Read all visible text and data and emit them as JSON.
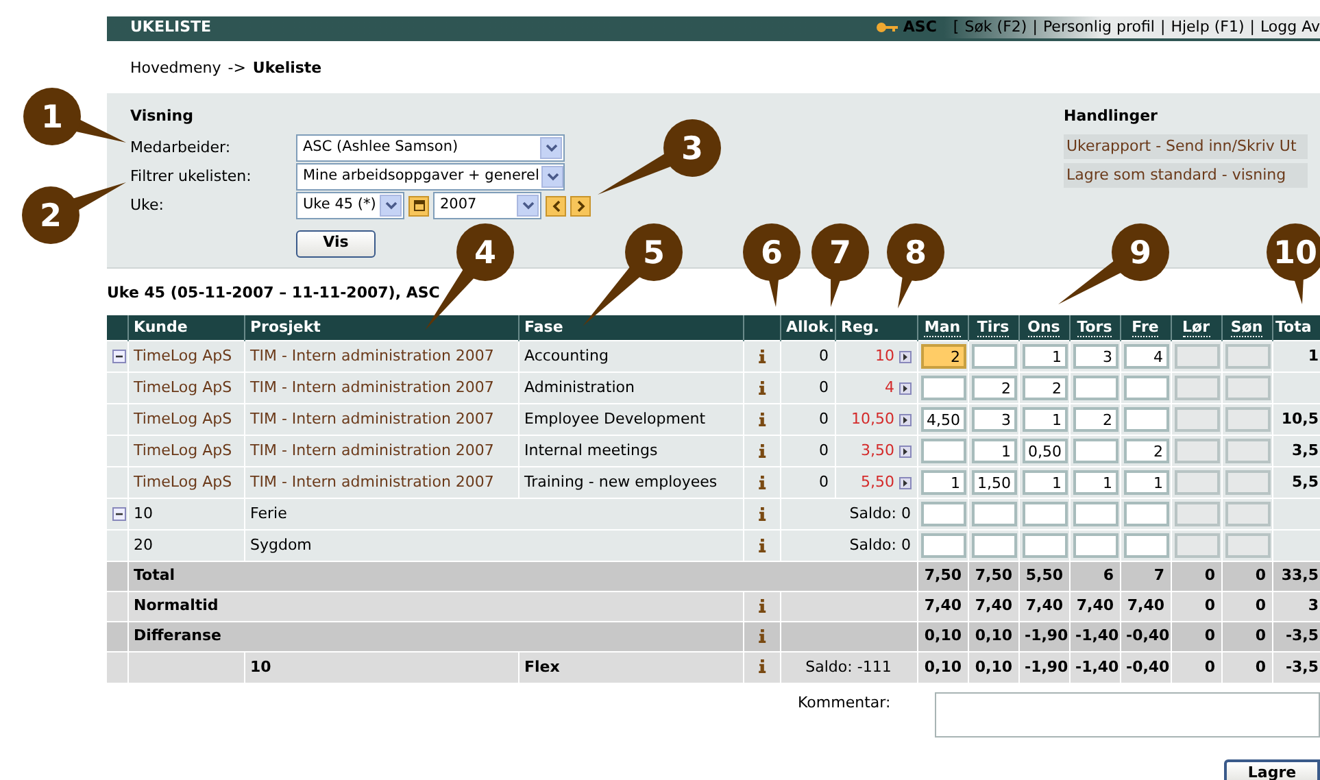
{
  "header": {
    "title": "UKELISTE",
    "user": "ASC",
    "open_bracket": "[",
    "separator": "|",
    "links": [
      "Søk (F2)",
      "Personlig profil",
      "Hjelp (F1)",
      "Logg Av"
    ]
  },
  "breadcrumb": {
    "parent": "Hovedmeny",
    "arrow": "->",
    "current": "Ukeliste"
  },
  "view": {
    "heading": "Visning",
    "fields": [
      {
        "kind": "select",
        "label": "Medarbeider:",
        "value": "ASC (Ashlee Samson)"
      },
      {
        "kind": "select",
        "label": "Filtrer ukelisten:",
        "value": "Mine arbeidsoppgaver + generel"
      },
      {
        "kind": "week",
        "label": "Uke:",
        "value": "Uke 45 (*)",
        "year": "2007"
      }
    ],
    "button": "Vis"
  },
  "actions": {
    "heading": "Handlinger",
    "items": [
      "Ukerapport - Send inn/Skriv Ut",
      "Lagre som standard - visning"
    ]
  },
  "week_title": "Uke 45 (05-11-2007 – 11-11-2007), ASC",
  "table": {
    "columns": [
      "Kunde",
      "Prosjekt",
      "Fase",
      "Allok.",
      "Reg."
    ],
    "days": [
      "Man",
      "Tirs",
      "Ons",
      "Tors",
      "Fre",
      "Lør",
      "Søn"
    ],
    "total_column": "Tota",
    "rows": [
      {
        "kind": "task",
        "collapsible": true,
        "customer": "TimeLog ApS",
        "project": "TIM - Intern administration 2007",
        "phase": "Accounting",
        "allocated": "0",
        "registered": "10",
        "total": "1",
        "cells": [
          {
            "value": "2",
            "focused": true,
            "disabled": false
          },
          {
            "focused": false,
            "disabled": false
          },
          {
            "value": "1",
            "focused": false,
            "disabled": false
          },
          {
            "value": "3",
            "focused": false,
            "disabled": false
          },
          {
            "value": "4",
            "focused": false,
            "disabled": false
          },
          {
            "focused": false,
            "disabled": true
          },
          {
            "focused": false,
            "disabled": true
          }
        ]
      },
      {
        "kind": "task",
        "collapsible": false,
        "customer": "TimeLog ApS",
        "project": "TIM - Intern administration 2007",
        "phase": "Administration",
        "allocated": "0",
        "registered": "4",
        "cells": [
          {
            "focused": false,
            "disabled": false
          },
          {
            "value": "2",
            "focused": false,
            "disabled": false
          },
          {
            "value": "2",
            "focused": false,
            "disabled": false
          },
          {
            "focused": false,
            "disabled": false
          },
          {
            "focused": false,
            "disabled": false
          },
          {
            "focused": false,
            "disabled": true
          },
          {
            "focused": false,
            "disabled": true
          }
        ]
      },
      {
        "kind": "task",
        "collapsible": false,
        "customer": "TimeLog ApS",
        "project": "TIM - Intern administration 2007",
        "phase": "Employee Development",
        "allocated": "0",
        "registered": "10,50",
        "total": "10,5",
        "cells": [
          {
            "value": "4,50",
            "focused": false,
            "disabled": false
          },
          {
            "value": "3",
            "focused": false,
            "disabled": false
          },
          {
            "value": "1",
            "focused": false,
            "disabled": false
          },
          {
            "value": "2",
            "focused": false,
            "disabled": false
          },
          {
            "focused": false,
            "disabled": false
          },
          {
            "focused": false,
            "disabled": true
          },
          {
            "focused": false,
            "disabled": true
          }
        ]
      },
      {
        "kind": "task",
        "collapsible": false,
        "customer": "TimeLog ApS",
        "project": "TIM - Intern administration 2007",
        "phase": "Internal meetings",
        "allocated": "0",
        "registered": "3,50",
        "total": "3,5",
        "cells": [
          {
            "focused": false,
            "disabled": false
          },
          {
            "value": "1",
            "focused": false,
            "disabled": false
          },
          {
            "value": "0,50",
            "focused": false,
            "disabled": false
          },
          {
            "focused": false,
            "disabled": false
          },
          {
            "value": "2",
            "focused": false,
            "disabled": false
          },
          {
            "focused": false,
            "disabled": true
          },
          {
            "focused": false,
            "disabled": true
          }
        ]
      },
      {
        "kind": "task",
        "collapsible": false,
        "customer": "TimeLog ApS",
        "project": "TIM - Intern administration 2007",
        "phase": "Training - new employees",
        "allocated": "0",
        "registered": "5,50",
        "total": "5,5",
        "cells": [
          {
            "value": "1",
            "focused": false,
            "disabled": false
          },
          {
            "value": "1,50",
            "focused": false,
            "disabled": false
          },
          {
            "value": "1",
            "focused": false,
            "disabled": false
          },
          {
            "value": "1",
            "focused": false,
            "disabled": false
          },
          {
            "value": "1",
            "focused": false,
            "disabled": false
          },
          {
            "focused": false,
            "disabled": true
          },
          {
            "focused": false,
            "disabled": true
          }
        ]
      },
      {
        "kind": "absence",
        "collapsible": true,
        "code": "10",
        "name": "Ferie",
        "balance": "Saldo: 0",
        "cells": [
          {
            "focused": false,
            "disabled": false
          },
          {
            "focused": false,
            "disabled": false
          },
          {
            "focused": false,
            "disabled": false
          },
          {
            "focused": false,
            "disabled": false
          },
          {
            "focused": false,
            "disabled": false
          },
          {
            "focused": false,
            "disabled": true
          },
          {
            "focused": false,
            "disabled": true
          }
        ]
      },
      {
        "kind": "absence",
        "collapsible": false,
        "code": "20",
        "name": "Sygdom",
        "balance": "Saldo: 0",
        "cells": [
          {
            "focused": false,
            "disabled": false
          },
          {
            "focused": false,
            "disabled": false
          },
          {
            "focused": false,
            "disabled": false
          },
          {
            "focused": false,
            "disabled": false
          },
          {
            "focused": false,
            "disabled": false
          },
          {
            "focused": false,
            "disabled": true
          },
          {
            "focused": false,
            "disabled": true
          }
        ]
      }
    ],
    "summary": [
      {
        "kind": "total",
        "label": "Total",
        "values": [
          "7,50",
          "7,50",
          "5,50",
          "6",
          "7",
          "0",
          "0"
        ],
        "total": "33,5"
      },
      {
        "kind": "norm",
        "label": "Normaltid",
        "values": [
          "7,40",
          "7,40",
          "7,40",
          "7,40",
          "7,40",
          "0",
          "0"
        ],
        "total": "3"
      },
      {
        "kind": "norm",
        "label": "Differanse",
        "values": [
          "0,10",
          "0,10",
          "-1,90",
          "-1,40",
          "-0,40",
          "0",
          "0"
        ],
        "total": "-3,5"
      },
      {
        "kind": "flex",
        "code": "10",
        "label": "Flex",
        "balance": "Saldo: -111",
        "values": [
          "0,10",
          "0,10",
          "-1,90",
          "-1,40",
          "-0,40",
          "0",
          "0"
        ],
        "total": "-3,5"
      }
    ]
  },
  "comment": {
    "label": "Kommentar:"
  },
  "save_button": "Lagre",
  "callouts": [
    "1",
    "2",
    "3",
    "4",
    "5",
    "6",
    "7",
    "8",
    "9",
    "10"
  ]
}
